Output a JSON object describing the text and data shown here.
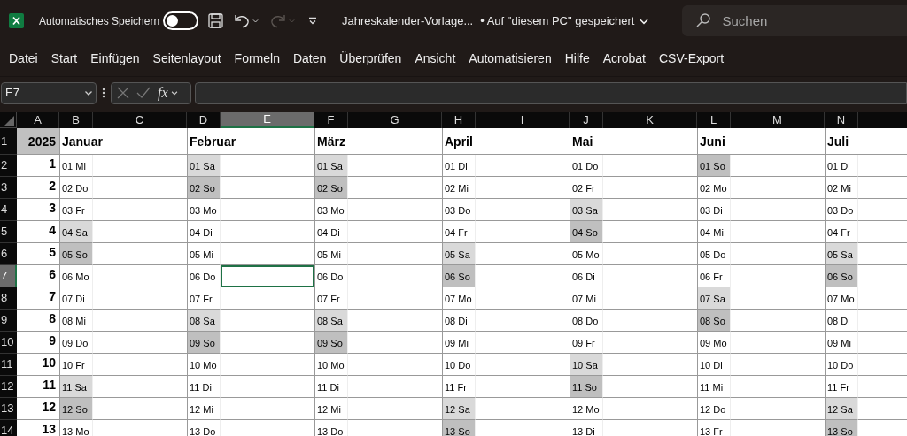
{
  "title_bar": {
    "autosave_label": "Automatisches Speichern",
    "autosave_on": false,
    "redo_disabled": true,
    "file_name": "Jahreskalender-Vorlage...",
    "save_status": "• Auf \"diesem PC\" gespeichert",
    "search": {
      "placeholder": "Suchen"
    }
  },
  "ribbon_tabs": [
    "Datei",
    "Start",
    "Einfügen",
    "Seitenlayout",
    "Formeln",
    "Daten",
    "Überprüfen",
    "Ansicht",
    "Automatisieren",
    "Hilfe",
    "Acrobat",
    "CSV-Export"
  ],
  "formula_bar": {
    "name_box": "E7",
    "fx": "fx"
  },
  "columns": [
    {
      "label": "A",
      "selected": false
    },
    {
      "label": "B",
      "selected": false
    },
    {
      "label": "C",
      "selected": false
    },
    {
      "label": "D",
      "selected": false
    },
    {
      "label": "E",
      "selected": true
    },
    {
      "label": "F",
      "selected": false
    },
    {
      "label": "G",
      "selected": false
    },
    {
      "label": "H",
      "selected": false
    },
    {
      "label": "I",
      "selected": false
    },
    {
      "label": "J",
      "selected": false
    },
    {
      "label": "K",
      "selected": false
    },
    {
      "label": "L",
      "selected": false
    },
    {
      "label": "M",
      "selected": false
    },
    {
      "label": "N",
      "selected": false
    }
  ],
  "row_numbers": [
    {
      "label": "1",
      "selected": false
    },
    {
      "label": "2",
      "selected": false
    },
    {
      "label": "3",
      "selected": false
    },
    {
      "label": "4",
      "selected": false
    },
    {
      "label": "5",
      "selected": false
    },
    {
      "label": "6",
      "selected": false
    },
    {
      "label": "7",
      "selected": true
    },
    {
      "label": "8",
      "selected": false
    },
    {
      "label": "9",
      "selected": false
    },
    {
      "label": "10",
      "selected": false
    },
    {
      "label": "11",
      "selected": false
    },
    {
      "label": "12",
      "selected": false
    },
    {
      "label": "13",
      "selected": false
    },
    {
      "label": "14",
      "selected": false
    }
  ],
  "year": "2025",
  "weeks": [
    "1",
    "2",
    "3",
    "4",
    "5",
    "6",
    "7",
    "8",
    "9",
    "10",
    "11",
    "12",
    "13"
  ],
  "months": [
    {
      "name": "Januar",
      "days": [
        {
          "label": "01 Mi",
          "kind": "weekday"
        },
        {
          "label": "02 Do",
          "kind": "weekday"
        },
        {
          "label": "03 Fr",
          "kind": "weekday"
        },
        {
          "label": "04 Sa",
          "kind": "saturday"
        },
        {
          "label": "05 So",
          "kind": "sunday"
        },
        {
          "label": "06 Mo",
          "kind": "weekday"
        },
        {
          "label": "07 Di",
          "kind": "weekday"
        },
        {
          "label": "08 Mi",
          "kind": "weekday"
        },
        {
          "label": "09 Do",
          "kind": "weekday"
        },
        {
          "label": "10 Fr",
          "kind": "weekday"
        },
        {
          "label": "11 Sa",
          "kind": "saturday"
        },
        {
          "label": "12 So",
          "kind": "sunday"
        },
        {
          "label": "13 Mo",
          "kind": "weekday"
        }
      ]
    },
    {
      "name": "Februar",
      "days": [
        {
          "label": "01 Sa",
          "kind": "saturday"
        },
        {
          "label": "02 So",
          "kind": "sunday"
        },
        {
          "label": "03 Mo",
          "kind": "weekday"
        },
        {
          "label": "04 Di",
          "kind": "weekday"
        },
        {
          "label": "05 Mi",
          "kind": "weekday"
        },
        {
          "label": "06 Do",
          "kind": "weekday"
        },
        {
          "label": "07 Fr",
          "kind": "weekday"
        },
        {
          "label": "08 Sa",
          "kind": "saturday"
        },
        {
          "label": "09 So",
          "kind": "sunday"
        },
        {
          "label": "10 Mo",
          "kind": "weekday"
        },
        {
          "label": "11 Di",
          "kind": "weekday"
        },
        {
          "label": "12 Mi",
          "kind": "weekday"
        },
        {
          "label": "13 Do",
          "kind": "weekday"
        }
      ]
    },
    {
      "name": "März",
      "days": [
        {
          "label": "01 Sa",
          "kind": "saturday"
        },
        {
          "label": "02 So",
          "kind": "sunday"
        },
        {
          "label": "03 Mo",
          "kind": "weekday"
        },
        {
          "label": "04 Di",
          "kind": "weekday"
        },
        {
          "label": "05 Mi",
          "kind": "weekday"
        },
        {
          "label": "06 Do",
          "kind": "weekday"
        },
        {
          "label": "07 Fr",
          "kind": "weekday"
        },
        {
          "label": "08 Sa",
          "kind": "saturday"
        },
        {
          "label": "09 So",
          "kind": "sunday"
        },
        {
          "label": "10 Mo",
          "kind": "weekday"
        },
        {
          "label": "11 Di",
          "kind": "weekday"
        },
        {
          "label": "12 Mi",
          "kind": "weekday"
        },
        {
          "label": "13 Do",
          "kind": "weekday"
        }
      ]
    },
    {
      "name": "April",
      "days": [
        {
          "label": "01 Di",
          "kind": "weekday"
        },
        {
          "label": "02 Mi",
          "kind": "weekday"
        },
        {
          "label": "03 Do",
          "kind": "weekday"
        },
        {
          "label": "04 Fr",
          "kind": "weekday"
        },
        {
          "label": "05 Sa",
          "kind": "saturday"
        },
        {
          "label": "06 So",
          "kind": "sunday"
        },
        {
          "label": "07 Mo",
          "kind": "weekday"
        },
        {
          "label": "08 Di",
          "kind": "weekday"
        },
        {
          "label": "09 Mi",
          "kind": "weekday"
        },
        {
          "label": "10 Do",
          "kind": "weekday"
        },
        {
          "label": "11 Fr",
          "kind": "weekday"
        },
        {
          "label": "12 Sa",
          "kind": "saturday"
        },
        {
          "label": "13 So",
          "kind": "sunday"
        }
      ]
    },
    {
      "name": "Mai",
      "days": [
        {
          "label": "01 Do",
          "kind": "weekday"
        },
        {
          "label": "02 Fr",
          "kind": "weekday"
        },
        {
          "label": "03 Sa",
          "kind": "saturday"
        },
        {
          "label": "04 So",
          "kind": "sunday"
        },
        {
          "label": "05 Mo",
          "kind": "weekday"
        },
        {
          "label": "06 Di",
          "kind": "weekday"
        },
        {
          "label": "07 Mi",
          "kind": "weekday"
        },
        {
          "label": "08 Do",
          "kind": "weekday"
        },
        {
          "label": "09 Fr",
          "kind": "weekday"
        },
        {
          "label": "10 Sa",
          "kind": "saturday"
        },
        {
          "label": "11 So",
          "kind": "sunday"
        },
        {
          "label": "12 Mo",
          "kind": "weekday"
        },
        {
          "label": "13 Di",
          "kind": "weekday"
        }
      ]
    },
    {
      "name": "Juni",
      "days": [
        {
          "label": "01 So",
          "kind": "sunday"
        },
        {
          "label": "02 Mo",
          "kind": "weekday"
        },
        {
          "label": "03 Di",
          "kind": "weekday"
        },
        {
          "label": "04 Mi",
          "kind": "weekday"
        },
        {
          "label": "05 Do",
          "kind": "weekday"
        },
        {
          "label": "06 Fr",
          "kind": "weekday"
        },
        {
          "label": "07 Sa",
          "kind": "saturday"
        },
        {
          "label": "08 So",
          "kind": "sunday"
        },
        {
          "label": "09 Mo",
          "kind": "weekday"
        },
        {
          "label": "10 Di",
          "kind": "weekday"
        },
        {
          "label": "11 Mi",
          "kind": "weekday"
        },
        {
          "label": "12 Do",
          "kind": "weekday"
        },
        {
          "label": "13 Fr",
          "kind": "weekday"
        }
      ]
    },
    {
      "name": "Juli",
      "days": [
        {
          "label": "01 Di",
          "kind": "weekday"
        },
        {
          "label": "02 Mi",
          "kind": "weekday"
        },
        {
          "label": "03 Do",
          "kind": "weekday"
        },
        {
          "label": "04 Fr",
          "kind": "weekday"
        },
        {
          "label": "05 Sa",
          "kind": "saturday"
        },
        {
          "label": "06 So",
          "kind": "sunday"
        },
        {
          "label": "07 Mo",
          "kind": "weekday"
        },
        {
          "label": "08 Di",
          "kind": "weekday"
        },
        {
          "label": "09 Mi",
          "kind": "weekday"
        },
        {
          "label": "10 Do",
          "kind": "weekday"
        },
        {
          "label": "11 Fr",
          "kind": "weekday"
        },
        {
          "label": "12 Sa",
          "kind": "saturday"
        },
        {
          "label": "13 So",
          "kind": "sunday"
        }
      ]
    }
  ]
}
